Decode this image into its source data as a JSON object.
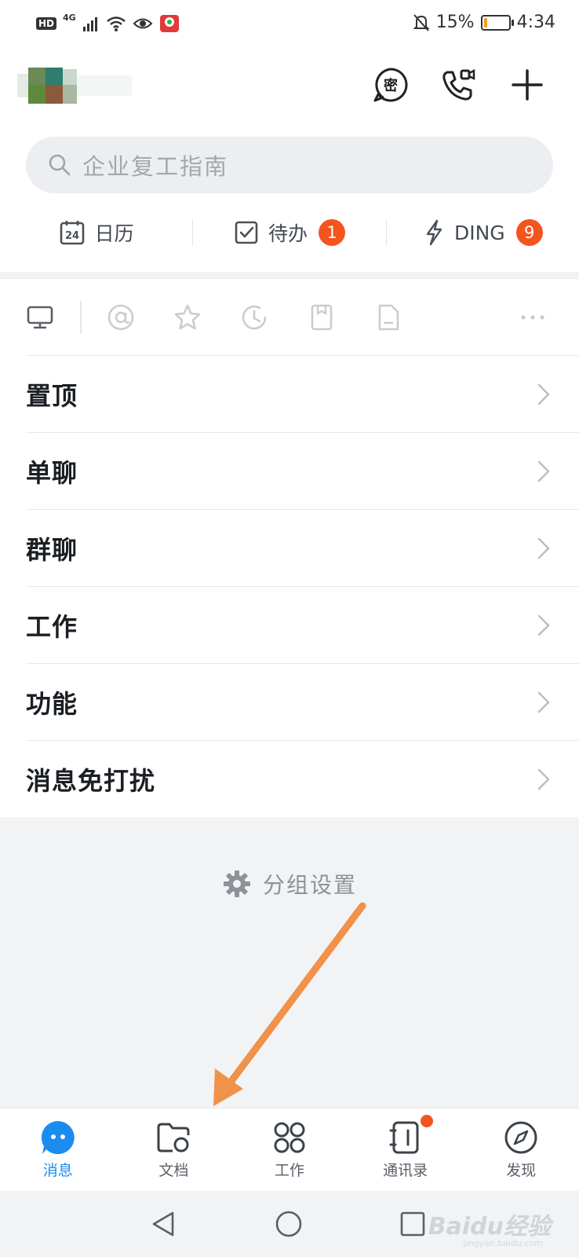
{
  "status_bar": {
    "hd": "HD",
    "network": "4G",
    "battery_percent": "15%",
    "battery_level": 0.15,
    "time": "4:34"
  },
  "header": {
    "icons": [
      "secret-chat-icon",
      "video-call-icon",
      "plus-icon"
    ]
  },
  "search": {
    "placeholder": "企业复工指南"
  },
  "quick_actions": [
    {
      "label": "日历",
      "icon": "calendar-icon",
      "icon_text": "24"
    },
    {
      "label": "待办",
      "icon": "todo-check-icon",
      "badge": "1"
    },
    {
      "label": "DING",
      "icon": "lightning-icon",
      "badge": "9"
    }
  ],
  "filters": [
    "desktop-icon",
    "at-icon",
    "star-icon",
    "history-icon",
    "bookmark-icon",
    "document-icon",
    "more-icon"
  ],
  "list": [
    {
      "label": "置顶"
    },
    {
      "label": "单聊"
    },
    {
      "label": "群聊"
    },
    {
      "label": "工作"
    },
    {
      "label": "功能"
    },
    {
      "label": "消息免打扰"
    }
  ],
  "group_settings": {
    "label": "分组设置"
  },
  "tabs": [
    {
      "label": "消息",
      "icon": "message-icon",
      "active": true
    },
    {
      "label": "文档",
      "icon": "folder-icon"
    },
    {
      "label": "工作",
      "icon": "apps-grid-icon"
    },
    {
      "label": "通讯录",
      "icon": "contacts-icon",
      "dot": true
    },
    {
      "label": "发现",
      "icon": "compass-icon"
    }
  ],
  "colors": {
    "accent": "#1a8cf0",
    "badge": "#f4541f",
    "arrow": "#f0924a"
  },
  "watermark": {
    "text": "Baidu经验",
    "sub": "jingyan.baidu.com"
  }
}
